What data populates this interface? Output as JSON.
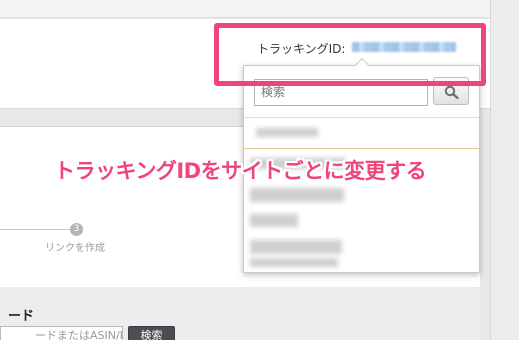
{
  "header": {
    "tracking_label": "トラッキングID:"
  },
  "dropdown": {
    "search_placeholder": "検索",
    "search_icon": "magnifier-icon"
  },
  "stepper": {
    "step_number": "3",
    "step_label": "リンクを作成"
  },
  "section": {
    "title": "ード",
    "search_placeholder": "ードまたはASIN/ISB",
    "search_button": "検索"
  },
  "annotation": {
    "text": "トラッキングIDをサイトごとに変更する",
    "color": "#f0457a"
  },
  "colors": {
    "highlight": "#f0457a",
    "button_dark": "#4a4d52"
  }
}
